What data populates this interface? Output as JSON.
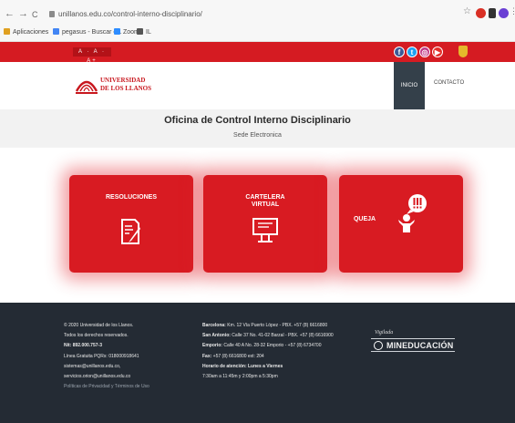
{
  "browser": {
    "back": "←",
    "forward": "→",
    "reload": "C",
    "url": "unillanos.edu.co/control-interno-disciplinario/",
    "bookmarks": [
      {
        "label": "Aplicaciones",
        "color": "#e0a020"
      },
      {
        "label": "pegasus - Buscar c...",
        "color": "#4285f4"
      },
      {
        "label": "Zoom",
        "color": "#2d8cff"
      },
      {
        "label": "IL",
        "color": "#555555"
      }
    ]
  },
  "topbar": {
    "font_controls": "A · A · A+",
    "social": [
      {
        "name": "facebook-icon",
        "glyph": "f",
        "color": "#3b5998"
      },
      {
        "name": "twitter-icon",
        "glyph": "t",
        "color": "#1da1f2"
      },
      {
        "name": "instagram-icon",
        "glyph": "◎",
        "color": "#c13584"
      },
      {
        "name": "youtube-icon",
        "glyph": "▶",
        "color": "#e52d27"
      }
    ]
  },
  "header": {
    "logo_line1": "UNIVERSIDAD",
    "logo_line2": "DE LOS LLANOS",
    "menu_inicio": "INICIO",
    "menu_contacto": "CONTACTO"
  },
  "title": {
    "main": "Oficina de Control Interno Disciplinario",
    "sub": "Sede Electronica"
  },
  "cards": [
    {
      "line1": "RESOLUCIONES",
      "line2": "",
      "icon": "document-pen-icon"
    },
    {
      "line1": "CARTELERA",
      "line2": "VIRTUAL",
      "icon": "billboard-icon"
    },
    {
      "line1": "QUEJA",
      "line2": "",
      "icon": "complaint-person-icon"
    }
  ],
  "footer": {
    "col1": [
      "© 2020 Universidad de los Llanos.",
      "Todos los derechos reservados.",
      "Nit: 892.000.757-3",
      "Línea Gratuita PQRs: 018000918641",
      "sistemas@unillanos.edu.co,",
      "servicios.orion@unillanos.edu.co",
      "Políticas de Privacidad y Términos de Uso"
    ],
    "col2": [
      {
        "k": "Barcelona:",
        "v": " Km. 12 Vía Puerto López - PBX. +57 (8) 6616800"
      },
      {
        "k": "San Antonio:",
        "v": " Calle 37 No. 41-02 Barzal - PBX. +57 (8) 6616900"
      },
      {
        "k": "Emporio:",
        "v": " Calle 40 A No. 28-32 Emporio - +57 (8) 6734700"
      },
      {
        "k": "Fax:",
        "v": " +57 (8) 6616800 ext: 204"
      },
      {
        "k": "Horario de atención: Lunes a Viernes",
        "v": ""
      },
      {
        "k": "",
        "v": "7:30am a 11:45m y 2:00pm a 5:30pm"
      }
    ],
    "vigilada": "Vigilada",
    "mineducacion": "MINEDUCACIÓN"
  }
}
